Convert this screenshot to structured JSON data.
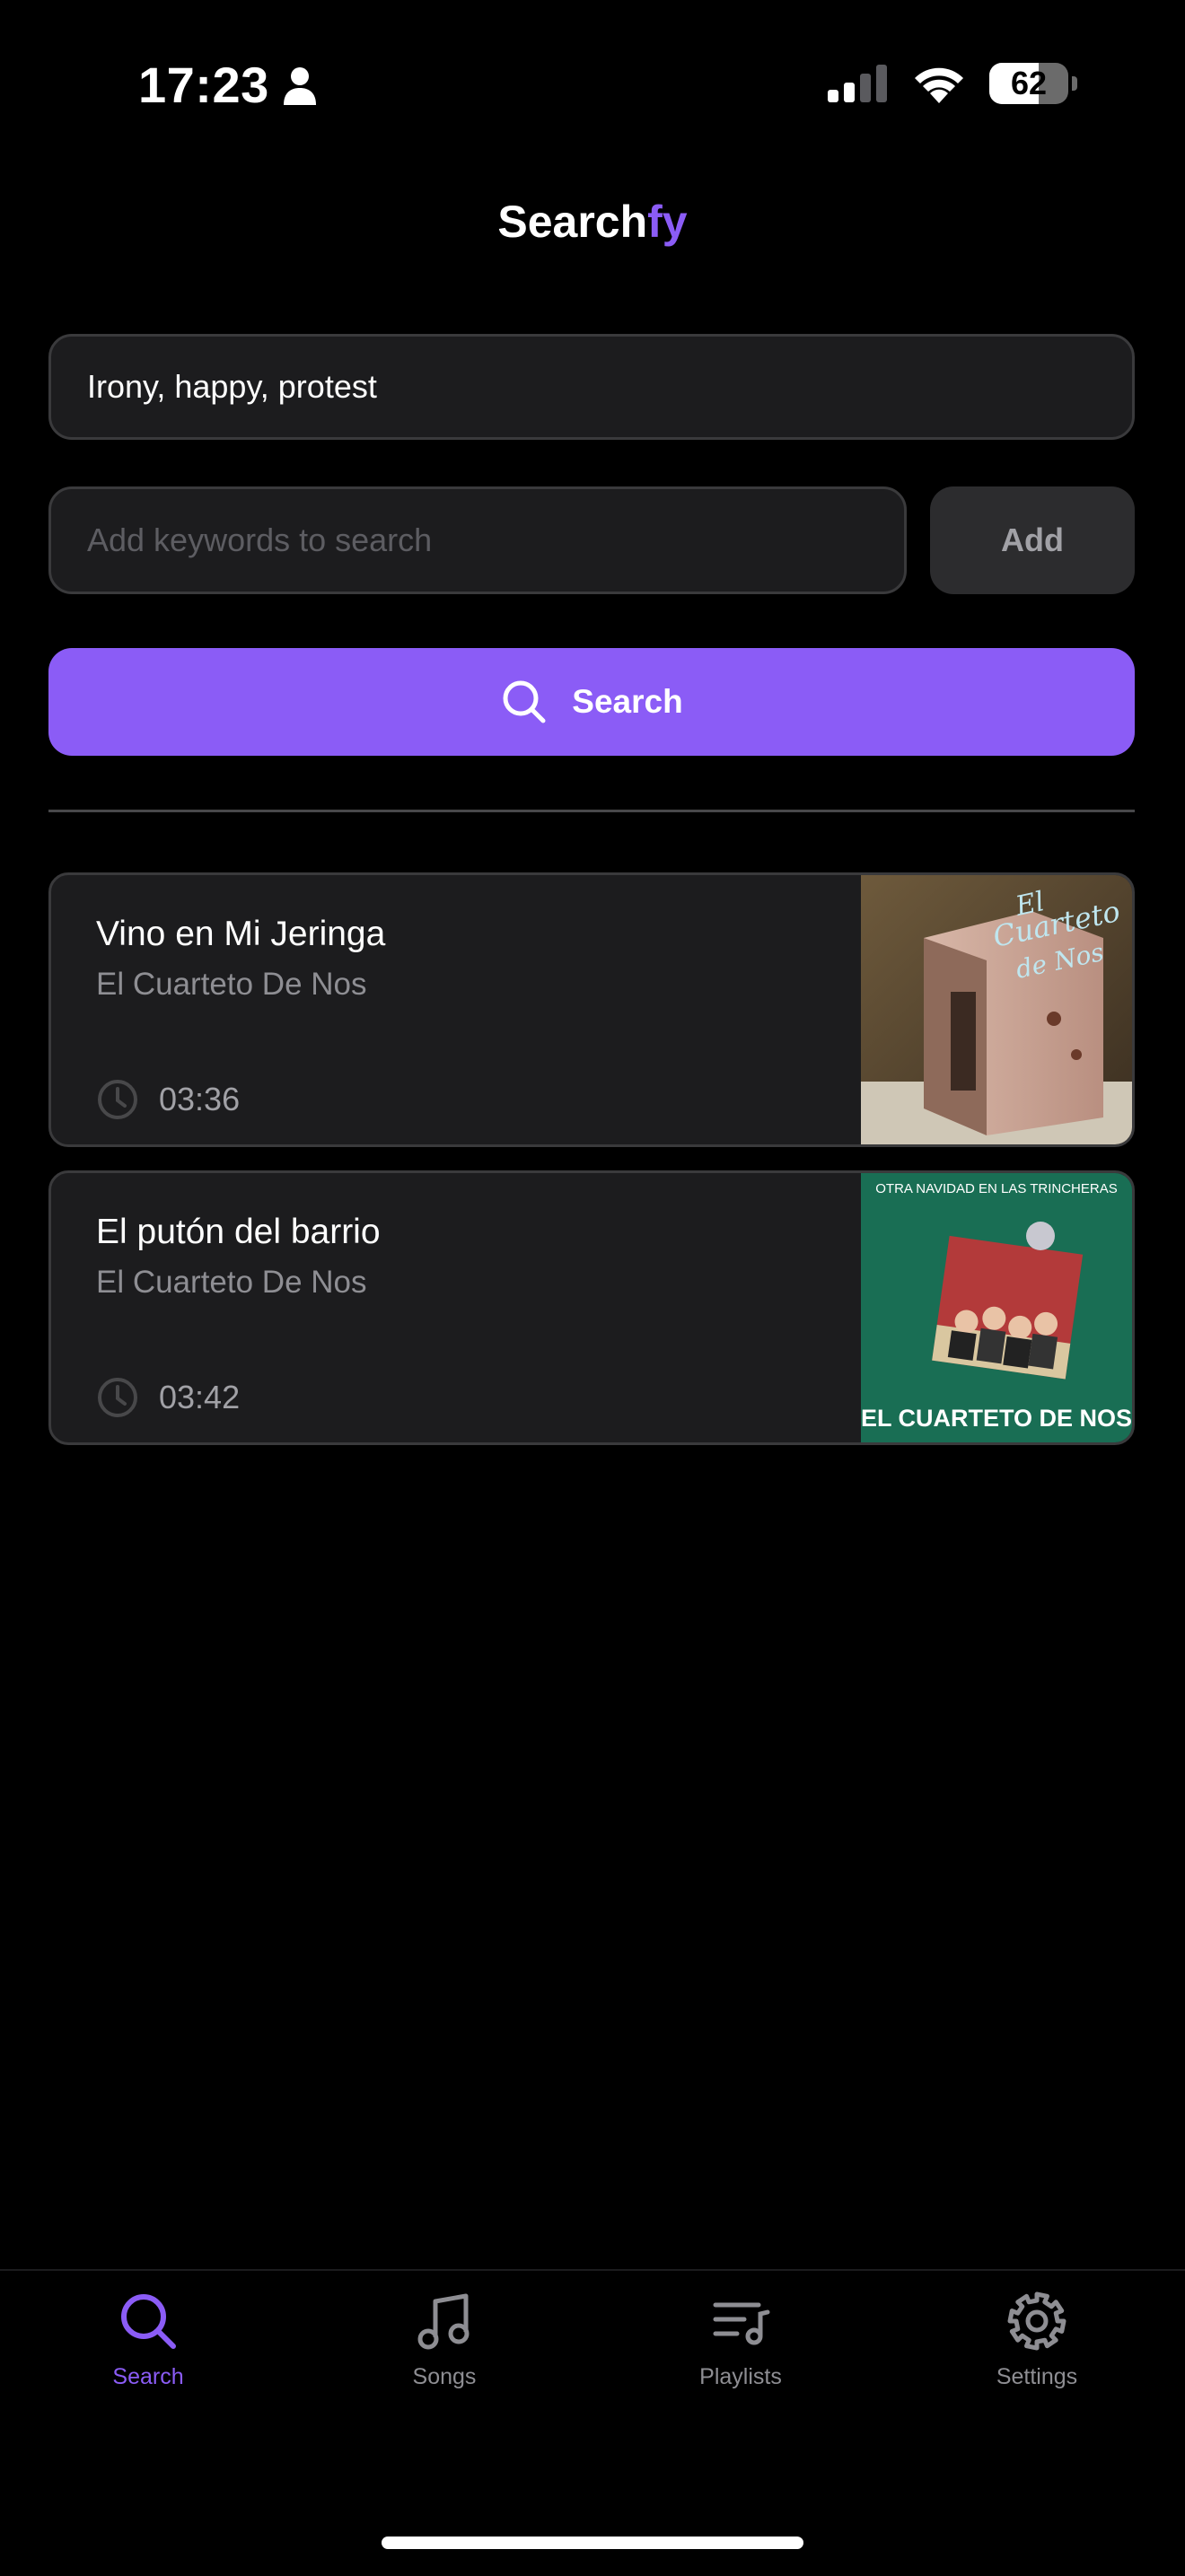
{
  "status_bar": {
    "time": "17:23",
    "battery_percent": "62",
    "battery_level": 0.62,
    "icons": [
      "person-icon",
      "signal-icon",
      "wifi-icon",
      "battery-icon"
    ]
  },
  "header": {
    "title_main": "Search",
    "title_accent": "fy",
    "accent_color": "#8b5cf6"
  },
  "search": {
    "keywords_value": "Irony, happy, protest",
    "add_placeholder": "Add keywords to search",
    "add_label": "Add",
    "search_label": "Search"
  },
  "results": [
    {
      "title": "Vino en Mi Jeringa",
      "artist": "El Cuarteto De Nos",
      "duration": "03:36",
      "cover_text": "El Cuarteto de Nos"
    },
    {
      "title": "El putón del barrio",
      "artist": "El Cuarteto De Nos",
      "duration": "03:42",
      "cover_top_text": "OTRA NAVIDAD EN LAS TRINCHERAS",
      "cover_bottom_text": "EL CUARTETO DE NOS"
    }
  ],
  "tab_bar": {
    "active": "Search",
    "tabs": [
      {
        "label": "Search",
        "icon": "search-icon"
      },
      {
        "label": "Songs",
        "icon": "music-note-icon"
      },
      {
        "label": "Playlists",
        "icon": "playlist-icon"
      },
      {
        "label": "Settings",
        "icon": "gear-icon"
      }
    ]
  },
  "colors": {
    "background": "#000000",
    "card": "#1c1c1e",
    "accent": "#8b5cf6",
    "muted_text": "#8e8e93"
  }
}
